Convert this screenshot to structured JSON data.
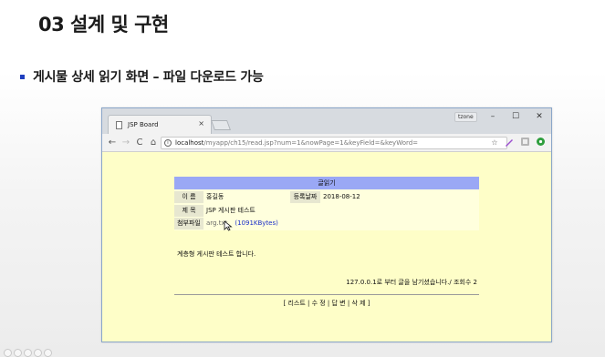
{
  "slide": {
    "title": "03 설계 및 구현",
    "bullet": "게시물 상세 읽기 화면 – 파일 다운로드 가능"
  },
  "browser": {
    "tab_title": "JSP Board",
    "tab_close": "×",
    "user_badge": "tzone",
    "window_buttons": {
      "minimize": "–",
      "maximize": "☐",
      "close": "✕"
    },
    "nav": {
      "back": "←",
      "forward": "→",
      "reload": "C",
      "home": "⌂"
    },
    "info_icon": "i",
    "url_host": "localhost",
    "url_path": "/myapp/ch15/read.jsp?num=1&nowPage=1&keyField=&keyWord=",
    "bookmark_star": "☆",
    "extensions": [
      "pen-icon",
      "ext-icon",
      "green-dot-icon"
    ]
  },
  "board": {
    "header": "글읽기",
    "labels": {
      "name": "이 름",
      "date": "등록날짜",
      "subject": "제 목",
      "attachment": "첨부파일"
    },
    "values": {
      "name": "홍길동",
      "date": "2018-08-12",
      "subject": "JSP 게시판 테스트",
      "file_name": "arg.txt",
      "file_size": "(1091KBytes)"
    },
    "content": "계층형 게시판 테스트 합니다.",
    "ip_info": "127.0.0.1로 부터 글을 남기셨습니다./ 조회수 2",
    "actions": "[ 리스트 | 수 정 | 답 변 | 삭 제 ]"
  },
  "colors": {
    "page_bg": "#fefec8",
    "header_bg": "#9aa8f5",
    "bullet": "#1f3fbf",
    "file_size_link": "#1b2fc9"
  }
}
